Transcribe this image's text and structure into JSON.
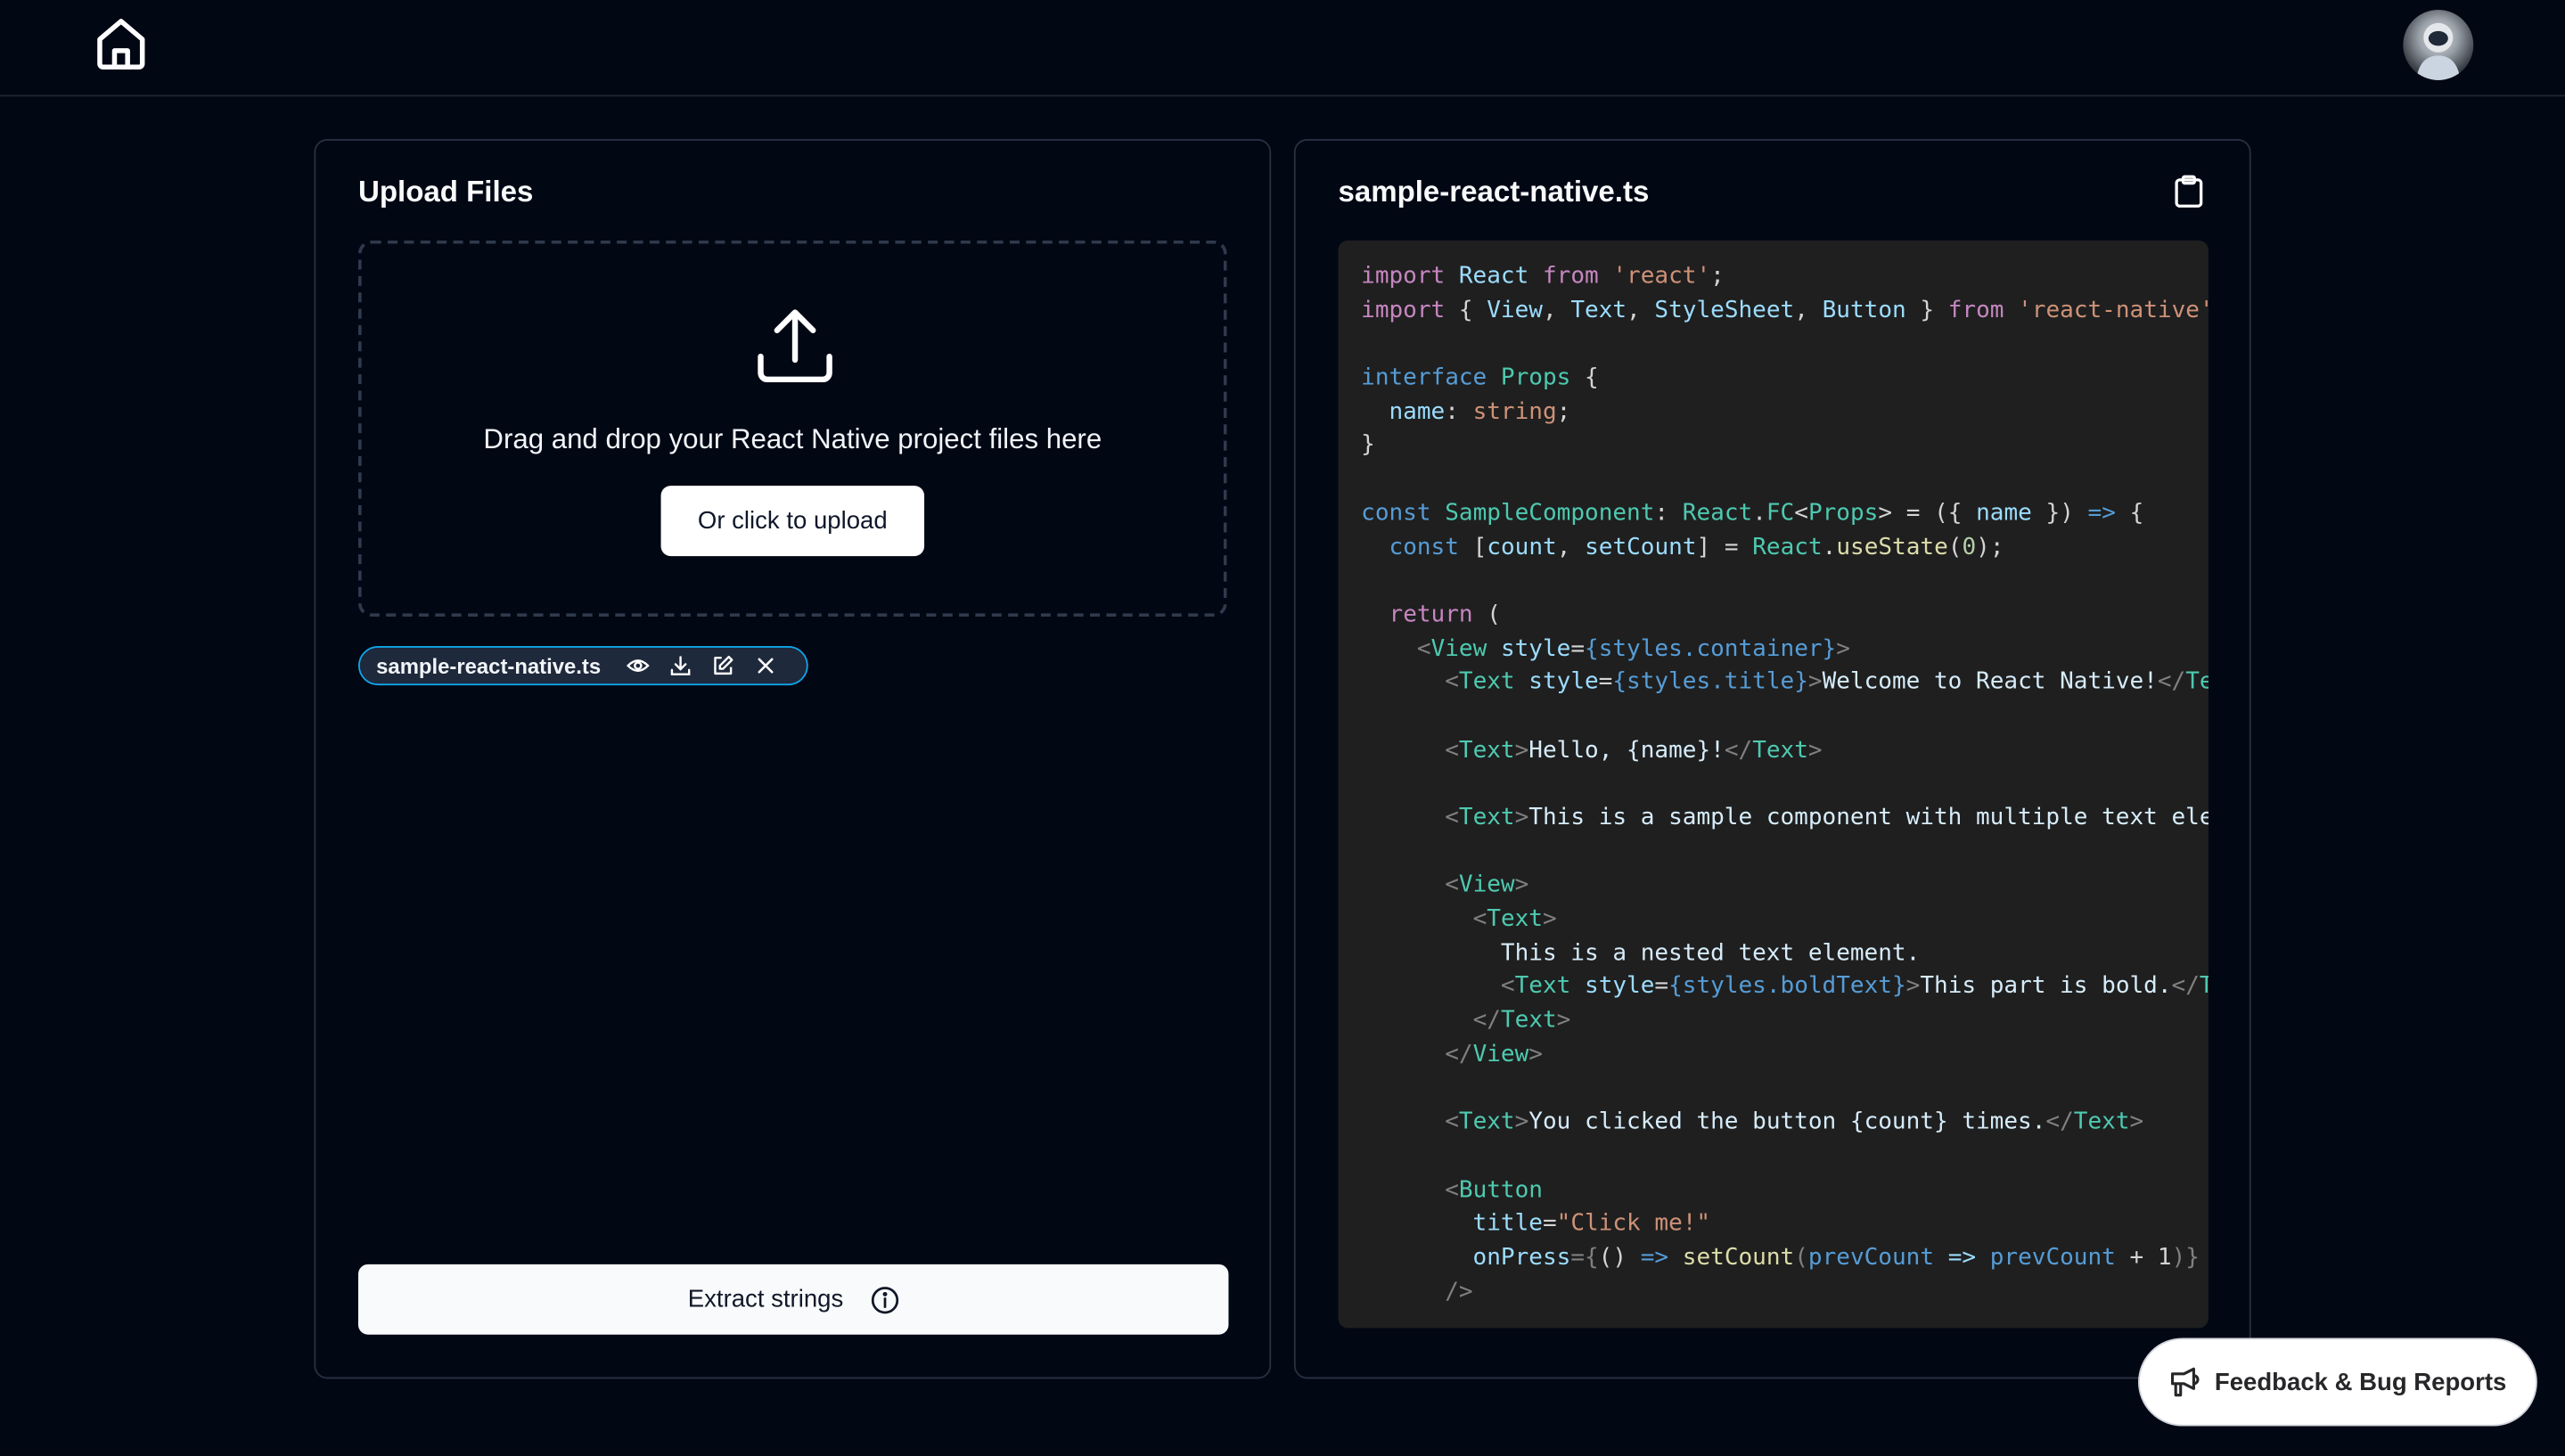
{
  "header": {
    "home_icon": "home-icon",
    "avatar": "astronaut-avatar"
  },
  "upload": {
    "title": "Upload Files",
    "drop_text": "Drag and drop your React Native project files here",
    "upload_button": "Or click to upload",
    "file_chip": {
      "name": "sample-react-native.ts",
      "icons": [
        "eye-icon",
        "download-icon",
        "edit-icon",
        "close-icon"
      ]
    },
    "extract_button": "Extract strings"
  },
  "preview": {
    "title": "sample-react-native.ts",
    "copy_icon": "clipboard-icon",
    "code_lines": [
      [
        [
          "import",
          "k"
        ],
        [
          " React ",
          "v"
        ],
        [
          "from",
          "k"
        ],
        [
          " ",
          "p"
        ],
        [
          "'react'",
          "s"
        ],
        [
          ";",
          "p"
        ]
      ],
      [
        [
          "import",
          "k"
        ],
        [
          " { ",
          "p"
        ],
        [
          "View",
          "v"
        ],
        [
          ", ",
          "p"
        ],
        [
          "Text",
          "v"
        ],
        [
          ", ",
          "p"
        ],
        [
          "StyleSheet",
          "v"
        ],
        [
          ", ",
          "p"
        ],
        [
          "Button",
          "v"
        ],
        [
          " } ",
          "p"
        ],
        [
          "from",
          "k"
        ],
        [
          " ",
          "p"
        ],
        [
          "'react-native'",
          "s"
        ]
      ],
      [],
      [
        [
          "interface",
          "b"
        ],
        [
          " ",
          "p"
        ],
        [
          "Props",
          "t"
        ],
        [
          " {",
          "p"
        ]
      ],
      [
        [
          "  name",
          "v"
        ],
        [
          ": ",
          "p"
        ],
        [
          "string",
          "s"
        ],
        [
          ";",
          "p"
        ]
      ],
      [
        [
          "}",
          "p"
        ]
      ],
      [],
      [
        [
          "const",
          "b"
        ],
        [
          " ",
          "p"
        ],
        [
          "SampleComponent",
          "t"
        ],
        [
          ": ",
          "p"
        ],
        [
          "React",
          "t"
        ],
        [
          ".",
          "p"
        ],
        [
          "FC",
          "t"
        ],
        [
          "<",
          "p"
        ],
        [
          "Props",
          "t"
        ],
        [
          "> = ({ ",
          "p"
        ],
        [
          "name",
          "v"
        ],
        [
          " }) ",
          "p"
        ],
        [
          "=>",
          "b"
        ],
        [
          " {",
          "p"
        ]
      ],
      [
        [
          "  ",
          "p"
        ],
        [
          "const",
          "b"
        ],
        [
          " [",
          "p"
        ],
        [
          "count",
          "v"
        ],
        [
          ", ",
          "p"
        ],
        [
          "setCount",
          "v"
        ],
        [
          "] = ",
          "p"
        ],
        [
          "React",
          "t"
        ],
        [
          ".",
          "p"
        ],
        [
          "useState",
          "f"
        ],
        [
          "(",
          "p"
        ],
        [
          "0",
          "n"
        ],
        [
          ");",
          "p"
        ]
      ],
      [],
      [
        [
          "  ",
          "p"
        ],
        [
          "return",
          "k"
        ],
        [
          " (",
          "p"
        ]
      ],
      [
        [
          "    ",
          "p"
        ],
        [
          "<",
          "g"
        ],
        [
          "View",
          "t"
        ],
        [
          " style",
          "v"
        ],
        [
          "=",
          "p"
        ],
        [
          "{styles.container}",
          "b"
        ],
        [
          ">",
          "g"
        ]
      ],
      [
        [
          "      ",
          "p"
        ],
        [
          "<",
          "g"
        ],
        [
          "Text",
          "t"
        ],
        [
          " style",
          "v"
        ],
        [
          "=",
          "p"
        ],
        [
          "{styles.title}",
          "b"
        ],
        [
          ">",
          "g"
        ],
        [
          "Welcome to React Native!",
          "x"
        ],
        [
          "</",
          "g"
        ],
        [
          "Te",
          "t"
        ]
      ],
      [],
      [
        [
          "      ",
          "p"
        ],
        [
          "<",
          "g"
        ],
        [
          "Text",
          "t"
        ],
        [
          ">",
          "g"
        ],
        [
          "Hello, {name}!",
          "x"
        ],
        [
          "</",
          "g"
        ],
        [
          "Text",
          "t"
        ],
        [
          ">",
          "g"
        ]
      ],
      [],
      [
        [
          "      ",
          "p"
        ],
        [
          "<",
          "g"
        ],
        [
          "Text",
          "t"
        ],
        [
          ">",
          "g"
        ],
        [
          "This is a sample component with multiple text ele",
          "x"
        ]
      ],
      [],
      [
        [
          "      ",
          "p"
        ],
        [
          "<",
          "g"
        ],
        [
          "View",
          "t"
        ],
        [
          ">",
          "g"
        ]
      ],
      [
        [
          "        ",
          "p"
        ],
        [
          "<",
          "g"
        ],
        [
          "Text",
          "t"
        ],
        [
          ">",
          "g"
        ]
      ],
      [
        [
          "          This is a nested text element.",
          "x"
        ]
      ],
      [
        [
          "          ",
          "p"
        ],
        [
          "<",
          "g"
        ],
        [
          "Text",
          "t"
        ],
        [
          " style",
          "v"
        ],
        [
          "=",
          "p"
        ],
        [
          "{styles.boldText}",
          "b"
        ],
        [
          ">",
          "g"
        ],
        [
          "This part is bold.",
          "x"
        ],
        [
          "</",
          "g"
        ],
        [
          "T",
          "t"
        ]
      ],
      [
        [
          "        ",
          "p"
        ],
        [
          "</",
          "g"
        ],
        [
          "Text",
          "t"
        ],
        [
          ">",
          "g"
        ]
      ],
      [
        [
          "      ",
          "p"
        ],
        [
          "</",
          "g"
        ],
        [
          "View",
          "t"
        ],
        [
          ">",
          "g"
        ]
      ],
      [],
      [
        [
          "      ",
          "p"
        ],
        [
          "<",
          "g"
        ],
        [
          "Text",
          "t"
        ],
        [
          ">",
          "g"
        ],
        [
          "You clicked the button {count} times.",
          "x"
        ],
        [
          "</",
          "g"
        ],
        [
          "Text",
          "t"
        ],
        [
          ">",
          "g"
        ]
      ],
      [],
      [
        [
          "      ",
          "p"
        ],
        [
          "<",
          "g"
        ],
        [
          "Button",
          "t"
        ]
      ],
      [
        [
          "        title",
          "v"
        ],
        [
          "=",
          "p"
        ],
        [
          "\"Click me!\"",
          "s"
        ]
      ],
      [
        [
          "        onPress",
          "v"
        ],
        [
          "={",
          "g"
        ],
        [
          "() ",
          "p"
        ],
        [
          "=>",
          "b"
        ],
        [
          " ",
          "p"
        ],
        [
          "setCount",
          "f"
        ],
        [
          "(",
          "g"
        ],
        [
          "prevCount",
          "b"
        ],
        [
          " => ",
          "v"
        ],
        [
          "prevCount",
          "b"
        ],
        [
          " + 1",
          "p"
        ],
        [
          ")}",
          "g"
        ]
      ],
      [
        [
          "      ",
          "p"
        ],
        [
          "/>",
          "g"
        ]
      ]
    ]
  },
  "feedback_button": "Feedback & Bug Reports",
  "colors": {
    "background": "#020714",
    "chip_border": "#0ea5e9",
    "code_background": "#1f1f1f",
    "card_border": "#283040"
  }
}
